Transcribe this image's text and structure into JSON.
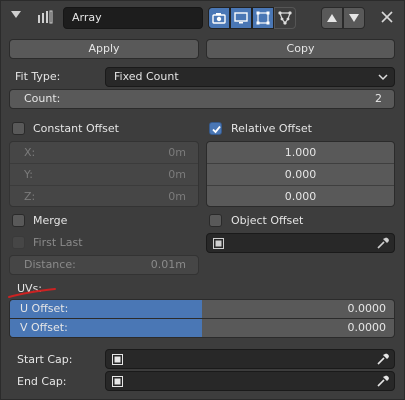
{
  "header": {
    "modifier_name": "Array",
    "icons": [
      "wrench-array-icon",
      "camera-icon",
      "monitor-icon",
      "edit-mode-icon",
      "cage-icon",
      "move-up-icon",
      "move-down-icon",
      "close-icon"
    ]
  },
  "buttons": {
    "apply": "Apply",
    "copy": "Copy"
  },
  "fit_type": {
    "label": "Fit Type:",
    "value": "Fixed Count"
  },
  "count": {
    "label": "Count:",
    "value": "2"
  },
  "constant_offset": {
    "label": "Constant Offset",
    "checked": false,
    "x_label": "X:",
    "x_value": "0m",
    "y_label": "Y:",
    "y_value": "0m",
    "z_label": "Z:",
    "z_value": "0m"
  },
  "relative_offset": {
    "label": "Relative Offset",
    "checked": true,
    "x": "1.000",
    "y": "0.000",
    "z": "0.000"
  },
  "merge": {
    "label": "Merge",
    "checked": false
  },
  "first_last": {
    "label": "First Last",
    "checked": false
  },
  "distance": {
    "label": "Distance:",
    "value": "0.01m"
  },
  "object_offset": {
    "label": "Object Offset",
    "checked": false,
    "value": ""
  },
  "uvs": {
    "label": "UVs:",
    "u_label": "U Offset:",
    "u_value": "0.0000",
    "v_label": "V Offset:",
    "v_value": "0.0000"
  },
  "start_cap": {
    "label": "Start Cap:",
    "value": ""
  },
  "end_cap": {
    "label": "End Cap:",
    "value": ""
  },
  "colors": {
    "accent": "#4a77b5",
    "panel": "#3d3d3d",
    "field": "#595959",
    "annotation": "#cc2222"
  }
}
